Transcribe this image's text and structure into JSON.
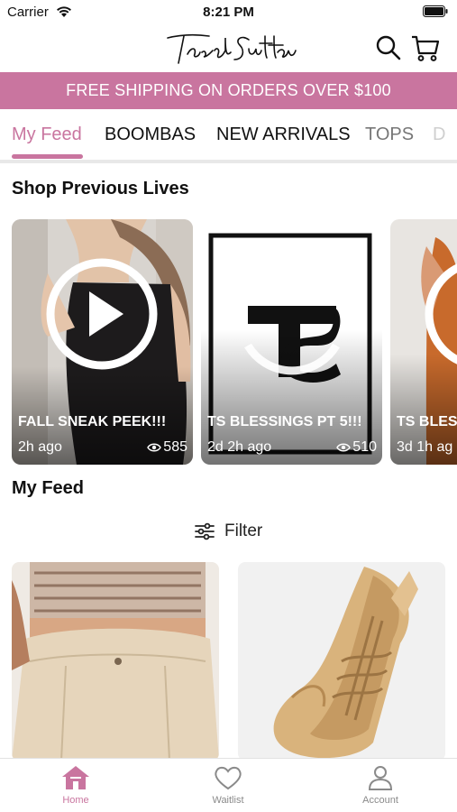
{
  "status_bar": {
    "carrier": "Carrier",
    "time": "8:21 PM"
  },
  "header": {
    "logo_text": "Tasah Sutton",
    "search_icon": "search-icon",
    "cart_icon": "cart-icon"
  },
  "promo": {
    "text": "FREE SHIPPING ON ORDERS OVER $100"
  },
  "tabs": [
    {
      "label": "My Feed",
      "active": true
    },
    {
      "label": "BOOMBAS"
    },
    {
      "label": "NEW ARRIVALS"
    },
    {
      "label": "TOPS"
    },
    {
      "label": "D"
    }
  ],
  "lives": {
    "title": "Shop Previous Lives",
    "items": [
      {
        "title": "FALL SNEAK PEEK!!!",
        "time": "2h ago",
        "views": "585"
      },
      {
        "title": "TS BLESSINGS PT 5!!!",
        "time": "2d 2h ago",
        "views": "510"
      },
      {
        "title": "TS BLESS",
        "time": "3d 1h ag",
        "views": ""
      }
    ]
  },
  "feed": {
    "title": "My Feed",
    "filter_label": "Filter"
  },
  "bottom_nav": [
    {
      "label": "Home",
      "icon": "home-icon",
      "active": true
    },
    {
      "label": "Waitlist",
      "icon": "heart-icon"
    },
    {
      "label": "Account",
      "icon": "account-icon"
    }
  ],
  "colors": {
    "accent": "#c9759f",
    "promo_bg": "#c9759f",
    "text": "#111111",
    "muted": "#8a8a8a"
  }
}
